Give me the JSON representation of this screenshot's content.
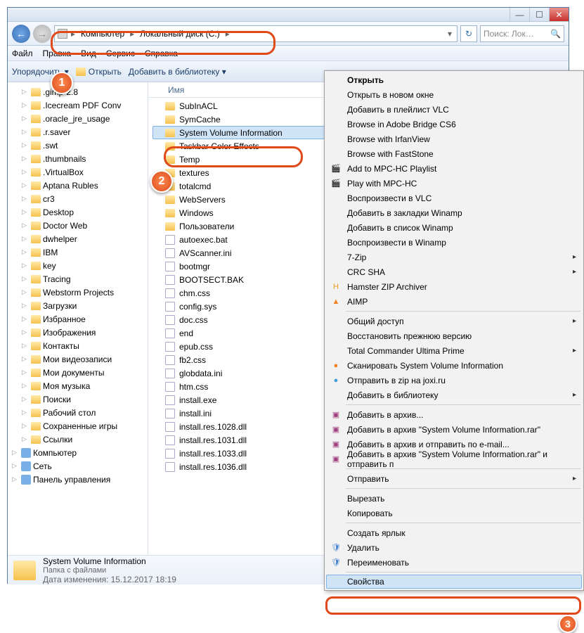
{
  "titlebar": {
    "min": "—",
    "max": "☐",
    "close": "✕"
  },
  "nav": {
    "back": "←",
    "fwd": "→",
    "crumbs": [
      "Компьютер",
      "Локальный диск (C:)"
    ],
    "refresh": "↻",
    "search_placeholder": "Поиск: Лок…"
  },
  "menu": [
    "Файл",
    "Правка",
    "Вид",
    "Сервис",
    "Справка"
  ],
  "toolbar": {
    "organize": "Упорядочить ▾",
    "open": "Открыть",
    "library": "Добавить в библиотеку ▾"
  },
  "tree": [
    {
      "t": "folder",
      "l": ".gimp-2.8"
    },
    {
      "t": "folder",
      "l": ".Icecream PDF Conv"
    },
    {
      "t": "folder",
      "l": ".oracle_jre_usage"
    },
    {
      "t": "folder",
      "l": ".r.saver"
    },
    {
      "t": "folder",
      "l": ".swt"
    },
    {
      "t": "folder",
      "l": ".thumbnails"
    },
    {
      "t": "folder",
      "l": ".VirtualBox"
    },
    {
      "t": "folder",
      "l": "Aptana Rubles"
    },
    {
      "t": "folder",
      "l": "cr3"
    },
    {
      "t": "folder",
      "l": "Desktop"
    },
    {
      "t": "folder",
      "l": "Doctor Web"
    },
    {
      "t": "folder",
      "l": "dwhelper"
    },
    {
      "t": "folder",
      "l": "IBM"
    },
    {
      "t": "folder",
      "l": "key"
    },
    {
      "t": "folder",
      "l": "Tracing"
    },
    {
      "t": "folder",
      "l": "Webstorm Projects"
    },
    {
      "t": "folder",
      "l": "Загрузки"
    },
    {
      "t": "folder",
      "l": "Избранное"
    },
    {
      "t": "folder",
      "l": "Изображения"
    },
    {
      "t": "folder",
      "l": "Контакты"
    },
    {
      "t": "folder",
      "l": "Мои видеозаписи"
    },
    {
      "t": "folder",
      "l": "Мои документы"
    },
    {
      "t": "folder",
      "l": "Моя музыка"
    },
    {
      "t": "folder",
      "l": "Поиски"
    },
    {
      "t": "folder",
      "l": "Рабочий стол"
    },
    {
      "t": "folder",
      "l": "Сохраненные игры"
    },
    {
      "t": "folder",
      "l": "Ссылки"
    },
    {
      "t": "sys",
      "l": "Компьютер"
    },
    {
      "t": "sys",
      "l": "Сеть"
    },
    {
      "t": "sys",
      "l": "Панель управления"
    }
  ],
  "list_head": "Имя",
  "list": [
    {
      "t": "folder",
      "l": "SubInACL"
    },
    {
      "t": "folder",
      "l": "SymCache"
    },
    {
      "t": "folder",
      "l": "System Volume Information",
      "sel": true
    },
    {
      "t": "folder",
      "l": "Taskbar Color Effects"
    },
    {
      "t": "folder",
      "l": "Temp"
    },
    {
      "t": "folder",
      "l": "textures"
    },
    {
      "t": "folder",
      "l": "totalcmd"
    },
    {
      "t": "folder",
      "l": "WebServers"
    },
    {
      "t": "folder",
      "l": "Windows"
    },
    {
      "t": "folder",
      "l": "Пользователи"
    },
    {
      "t": "file",
      "l": "autoexec.bat"
    },
    {
      "t": "file",
      "l": "AVScanner.ini"
    },
    {
      "t": "file",
      "l": "bootmgr"
    },
    {
      "t": "file",
      "l": "BOOTSECT.BAK"
    },
    {
      "t": "file",
      "l": "chm.css"
    },
    {
      "t": "file",
      "l": "config.sys"
    },
    {
      "t": "file",
      "l": "doc.css"
    },
    {
      "t": "file",
      "l": "end"
    },
    {
      "t": "file",
      "l": "epub.css"
    },
    {
      "t": "file",
      "l": "fb2.css"
    },
    {
      "t": "file",
      "l": "globdata.ini"
    },
    {
      "t": "file",
      "l": "htm.css"
    },
    {
      "t": "file",
      "l": "install.exe"
    },
    {
      "t": "file",
      "l": "install.ini"
    },
    {
      "t": "file",
      "l": "install.res.1028.dll"
    },
    {
      "t": "file",
      "l": "install.res.1031.dll"
    },
    {
      "t": "file",
      "l": "install.res.1033.dll"
    },
    {
      "t": "file",
      "l": "install.res.1036.dll"
    }
  ],
  "status": {
    "name": "System Volume Information",
    "type": "Папка с файлами",
    "date_label": "Дата изменения:",
    "date": "15.12.2017 18:19"
  },
  "ctx": [
    {
      "l": "Открыть",
      "b": true
    },
    {
      "l": "Открыть в новом окне"
    },
    {
      "l": "Добавить в плейлист VLC"
    },
    {
      "l": "Browse in Adobe Bridge CS6"
    },
    {
      "l": "Browse with IrfanView"
    },
    {
      "l": "Browse with FastStone"
    },
    {
      "l": "Add to MPC-HC Playlist",
      "i": "🎬"
    },
    {
      "l": "Play with MPC-HC",
      "i": "🎬"
    },
    {
      "l": "Воспроизвести в VLC"
    },
    {
      "l": "Добавить в закладки Winamp"
    },
    {
      "l": "Добавить в список Winamp"
    },
    {
      "l": "Воспроизвести в Winamp"
    },
    {
      "l": "7-Zip",
      "sub": true
    },
    {
      "l": "CRC SHA",
      "sub": true
    },
    {
      "l": "Hamster ZIP Archiver",
      "i": "H",
      "ic": "#f0a020"
    },
    {
      "l": "AIMP",
      "i": "▲",
      "ic": "#f08020"
    },
    {
      "sep": true
    },
    {
      "l": "Общий доступ",
      "sub": true
    },
    {
      "l": "Восстановить прежнюю версию"
    },
    {
      "l": "Total Commander Ultima Prime",
      "sub": true
    },
    {
      "l": "Сканировать System Volume Information",
      "i": "●",
      "ic": "#f08020"
    },
    {
      "l": "Отправить в zip на joxi.ru",
      "i": "●",
      "ic": "#40a0e0"
    },
    {
      "l": "Добавить в библиотеку",
      "sub": true
    },
    {
      "sep": true
    },
    {
      "l": "Добавить в архив...",
      "i": "▣",
      "ic": "#a04080"
    },
    {
      "l": "Добавить в архив \"System Volume Information.rar\"",
      "i": "▣",
      "ic": "#a04080"
    },
    {
      "l": "Добавить в архив и отправить по e-mail...",
      "i": "▣",
      "ic": "#a04080"
    },
    {
      "l": "Добавить в архив \"System Volume Information.rar\" и отправить п",
      "i": "▣",
      "ic": "#a04080"
    },
    {
      "sep": true
    },
    {
      "l": "Отправить",
      "sub": true
    },
    {
      "sep": true
    },
    {
      "l": "Вырезать"
    },
    {
      "l": "Копировать"
    },
    {
      "sep": true
    },
    {
      "l": "Создать ярлык"
    },
    {
      "l": "Удалить",
      "i": "🛡",
      "ic": "#4080d0"
    },
    {
      "l": "Переименовать",
      "i": "🛡",
      "ic": "#4080d0"
    },
    {
      "sep": true
    },
    {
      "l": "Свойства",
      "hl": true
    }
  ],
  "badges": {
    "1": "1",
    "2": "2",
    "3": "3"
  }
}
